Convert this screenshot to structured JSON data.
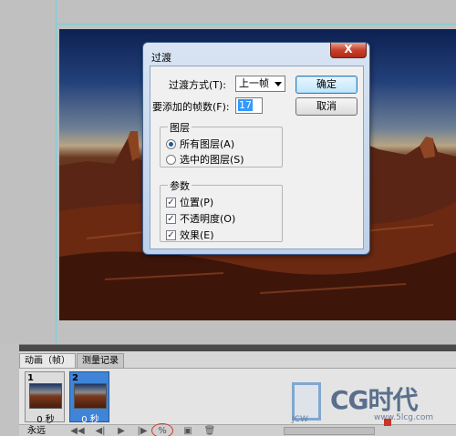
{
  "dialog": {
    "title": "过渡",
    "close_label": "X",
    "tween_with_label": "过渡方式(T):",
    "tween_with_value": "上一帧",
    "frames_to_add_label": "要添加的帧数(F):",
    "frames_to_add_value": "17",
    "ok_label": "确定",
    "cancel_label": "取消",
    "layers_group": {
      "title": "图层",
      "all_layers": "所有图层(A)",
      "selected_layers": "选中的图层(S)",
      "selected": "all_layers"
    },
    "params_group": {
      "title": "参数",
      "position": "位置(P)",
      "opacity": "不透明度(O)",
      "effects": "效果(E)",
      "position_checked": true,
      "opacity_checked": true,
      "effects_checked": true
    }
  },
  "animation_panel": {
    "tabs": [
      "动画（帧）",
      "测量记录"
    ],
    "frames": [
      {
        "number": "1",
        "delay": "0 秒",
        "selected": false
      },
      {
        "number": "2",
        "delay": "0 秒",
        "selected": true
      }
    ],
    "loop_option": "永远",
    "controls": {
      "first_frame": "◀◀",
      "prev_frame": "◀|",
      "play": "▶",
      "next_frame": "|▶",
      "tween": "%",
      "duplicate": "▣",
      "delete": "🗑"
    }
  },
  "watermark": {
    "main": "CG时代",
    "sub": "JCW",
    "url": "www.5lcg.com"
  },
  "colors": {
    "accent_selection": "#3f84d6",
    "highlight_circle": "#d23a2a",
    "guide": "#6fd3e0"
  }
}
